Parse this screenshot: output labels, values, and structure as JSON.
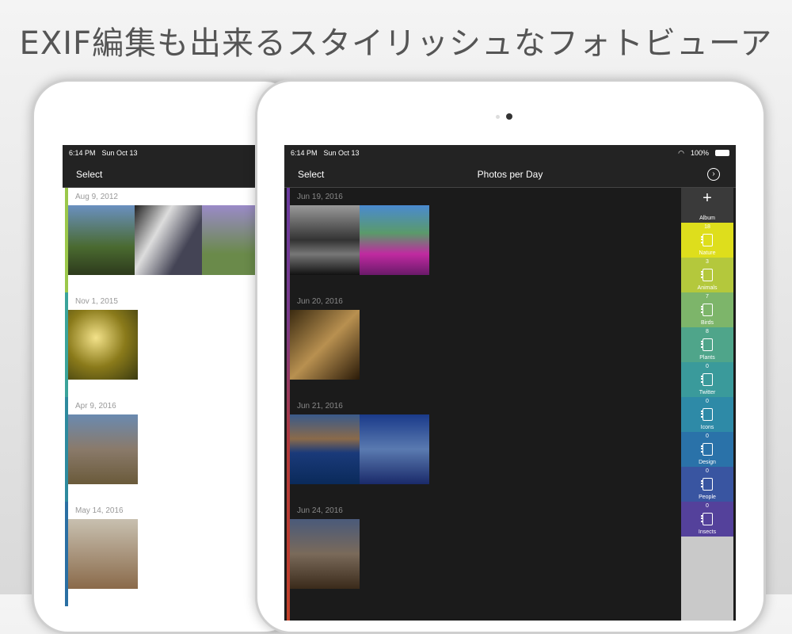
{
  "headline": "EXIF編集も出来るスタイリッシュなフォトビューア",
  "left_device": {
    "time": "6:14 PM",
    "date": "Sun Oct 13",
    "select": "Select",
    "groups": [
      {
        "date": "Aug 9, 2012",
        "strip": "#9bc84a"
      },
      {
        "date": "Nov 1, 2015",
        "strip": "#3aa39a"
      },
      {
        "date": "Apr 9, 2016",
        "strip": "#2d8a9e"
      },
      {
        "date": "May 14, 2016",
        "strip": "#2a6fa3"
      }
    ]
  },
  "right_device": {
    "time": "6:14 PM",
    "date": "Sun Oct 13",
    "battery": "100%",
    "select": "Select",
    "title": "Photos per Day",
    "groups": [
      {
        "date": "Jun 19, 2016"
      },
      {
        "date": "Jun 20, 2016"
      },
      {
        "date": "Jun 21, 2016"
      },
      {
        "date": "Jun 24, 2016"
      }
    ],
    "add_album": "Album",
    "albums": [
      {
        "name": "Nature",
        "count": "18",
        "color": "#dede1c"
      },
      {
        "name": "Animals",
        "count": "3",
        "color": "#b4c83c"
      },
      {
        "name": "Birds",
        "count": "7",
        "color": "#7db56a"
      },
      {
        "name": "Plants",
        "count": "8",
        "color": "#4fa58a"
      },
      {
        "name": "Twitter",
        "count": "0",
        "color": "#3a9a9b"
      },
      {
        "name": "Icons",
        "count": "0",
        "color": "#2e8aa7"
      },
      {
        "name": "Design",
        "count": "0",
        "color": "#2a72a9"
      },
      {
        "name": "People",
        "count": "0",
        "color": "#3955a1"
      },
      {
        "name": "Insects",
        "count": "0",
        "color": "#54419b"
      }
    ]
  }
}
